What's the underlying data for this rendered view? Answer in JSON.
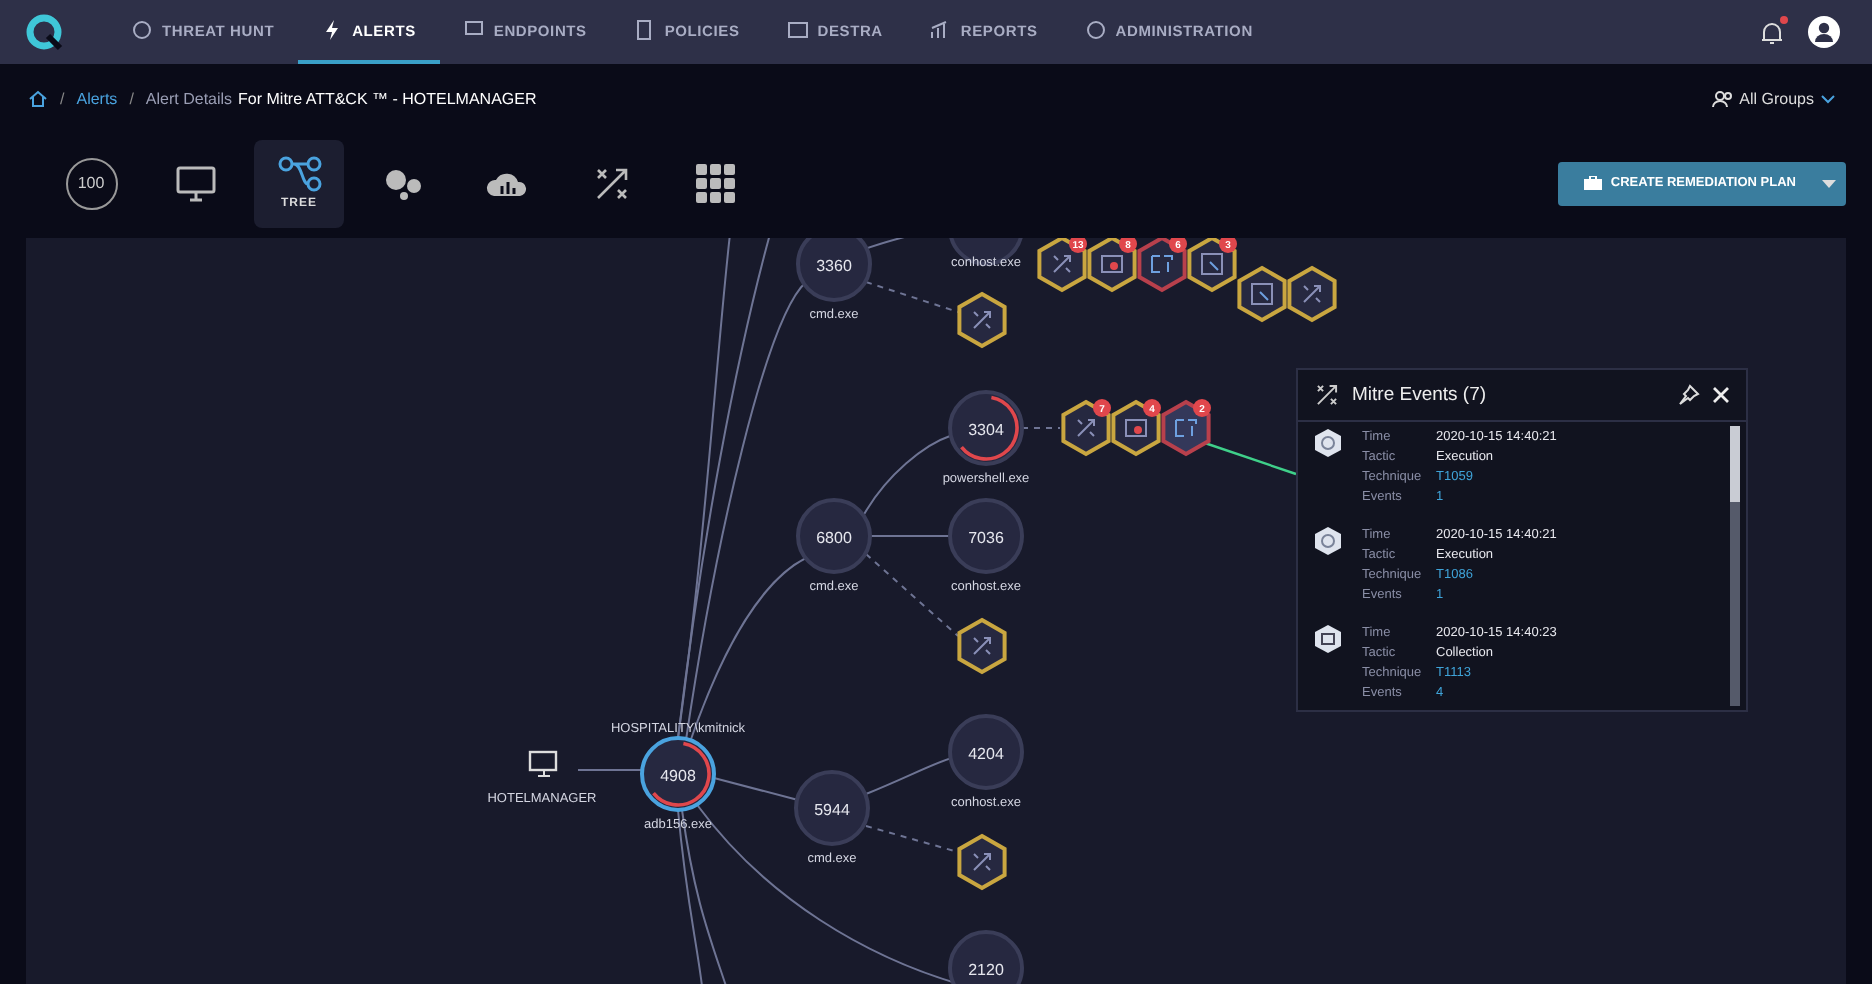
{
  "nav": {
    "items": [
      {
        "label": "THREAT HUNT",
        "selected": false
      },
      {
        "label": "ALERTS",
        "selected": true
      },
      {
        "label": "ENDPOINTS",
        "selected": false
      },
      {
        "label": "POLICIES",
        "selected": false
      },
      {
        "label": "DESTRA",
        "selected": false
      },
      {
        "label": "REPORTS",
        "selected": false
      },
      {
        "label": "ADMINISTRATION",
        "selected": false
      }
    ],
    "notification_unread": true
  },
  "breadcrumb": {
    "separators": [
      "/",
      "/"
    ],
    "link": "Alerts",
    "muted": "Alert Details",
    "current": "For Mitre ATT&CK ™ - HOTELMANAGER"
  },
  "groups": {
    "label": "All Groups"
  },
  "view_tabs": [
    {
      "kind": "score",
      "label": "100",
      "selected": false
    },
    {
      "kind": "monitor",
      "selected": false
    },
    {
      "kind": "tree",
      "label": "TREE",
      "selected": true
    },
    {
      "kind": "bubbles",
      "selected": false
    },
    {
      "kind": "cloud",
      "selected": false
    },
    {
      "kind": "mitre",
      "selected": false
    },
    {
      "kind": "grid",
      "selected": false
    }
  ],
  "remediation_button": {
    "label": "CREATE REMEDIATION PLAN"
  },
  "graph": {
    "host": {
      "name": "HOTELMANAGER",
      "user": "HOSPITALITY\\kmitnick"
    },
    "processes": [
      {
        "pid": "3360",
        "name": "cmd.exe",
        "alert": false,
        "selected": false
      },
      {
        "name": "conhost.exe",
        "alert": false,
        "selected": false
      },
      {
        "pid": "3304",
        "name": "powershell.exe",
        "alert": true,
        "selected": false
      },
      {
        "pid": "6800",
        "name": "cmd.exe",
        "alert": false,
        "selected": false
      },
      {
        "pid": "7036",
        "name": "conhost.exe",
        "alert": false,
        "selected": false
      },
      {
        "pid": "4908",
        "name": "adb156.exe",
        "alert": true,
        "selected": true
      },
      {
        "pid": "5944",
        "name": "cmd.exe",
        "alert": false,
        "selected": false
      },
      {
        "pid": "4204",
        "name": "conhost.exe",
        "alert": false,
        "selected": false
      },
      {
        "pid": "2120",
        "alert": false,
        "selected": false
      }
    ],
    "techniques": [
      {
        "kind": "mitre",
        "color": "#c9a640",
        "selected": false
      },
      {
        "kind": "mitre",
        "color": "#c9a640",
        "selected": false
      },
      {
        "kind": "mitre",
        "color": "#c9a640",
        "selected": false
      },
      {
        "kind": "mitre",
        "badge": "13",
        "color": "#c9a640",
        "selected": false
      },
      {
        "kind": "bug",
        "badge": "8",
        "color": "#c9a640",
        "selected": false
      },
      {
        "kind": "doc",
        "badge": "6",
        "color": "#b8404c",
        "selected": false
      },
      {
        "kind": "image",
        "badge": "3",
        "color": "#c9a640",
        "selected": false
      },
      {
        "kind": "image",
        "color": "#c9a640",
        "selected": false
      },
      {
        "kind": "mitre",
        "color": "#c9a640",
        "selected": false
      },
      {
        "kind": "mitre",
        "badge": "7",
        "color": "#c9a640",
        "selected": false
      },
      {
        "kind": "bug",
        "badge": "4",
        "color": "#c9a640",
        "selected": false
      },
      {
        "kind": "doc",
        "badge": "2",
        "color": "#b8404c",
        "selected": true
      }
    ]
  },
  "panel": {
    "title": "Mitre Events (7)",
    "events": [
      {
        "kind": "gear",
        "fields": [
          {
            "label": "Time",
            "value": "2020-10-15  14:40:21",
            "kind": "text"
          },
          {
            "label": "Tactic",
            "value": "Execution",
            "kind": "text"
          },
          {
            "label": "Technique",
            "value": "T1059",
            "kind": "link"
          },
          {
            "label": "Events",
            "value": "1",
            "kind": "count"
          }
        ]
      },
      {
        "kind": "gear",
        "fields": [
          {
            "label": "Time",
            "value": "2020-10-15  14:40:21",
            "kind": "text"
          },
          {
            "label": "Tactic",
            "value": "Execution",
            "kind": "text"
          },
          {
            "label": "Technique",
            "value": "T1086",
            "kind": "link"
          },
          {
            "label": "Events",
            "value": "1",
            "kind": "count"
          }
        ]
      },
      {
        "kind": "collect",
        "fields": [
          {
            "label": "Time",
            "value": "2020-10-15  14:40:23",
            "kind": "text"
          },
          {
            "label": "Tactic",
            "value": "Collection",
            "kind": "text"
          },
          {
            "label": "Technique",
            "value": "T1113",
            "kind": "link"
          },
          {
            "label": "Events",
            "value": "4",
            "kind": "count"
          }
        ]
      }
    ]
  }
}
